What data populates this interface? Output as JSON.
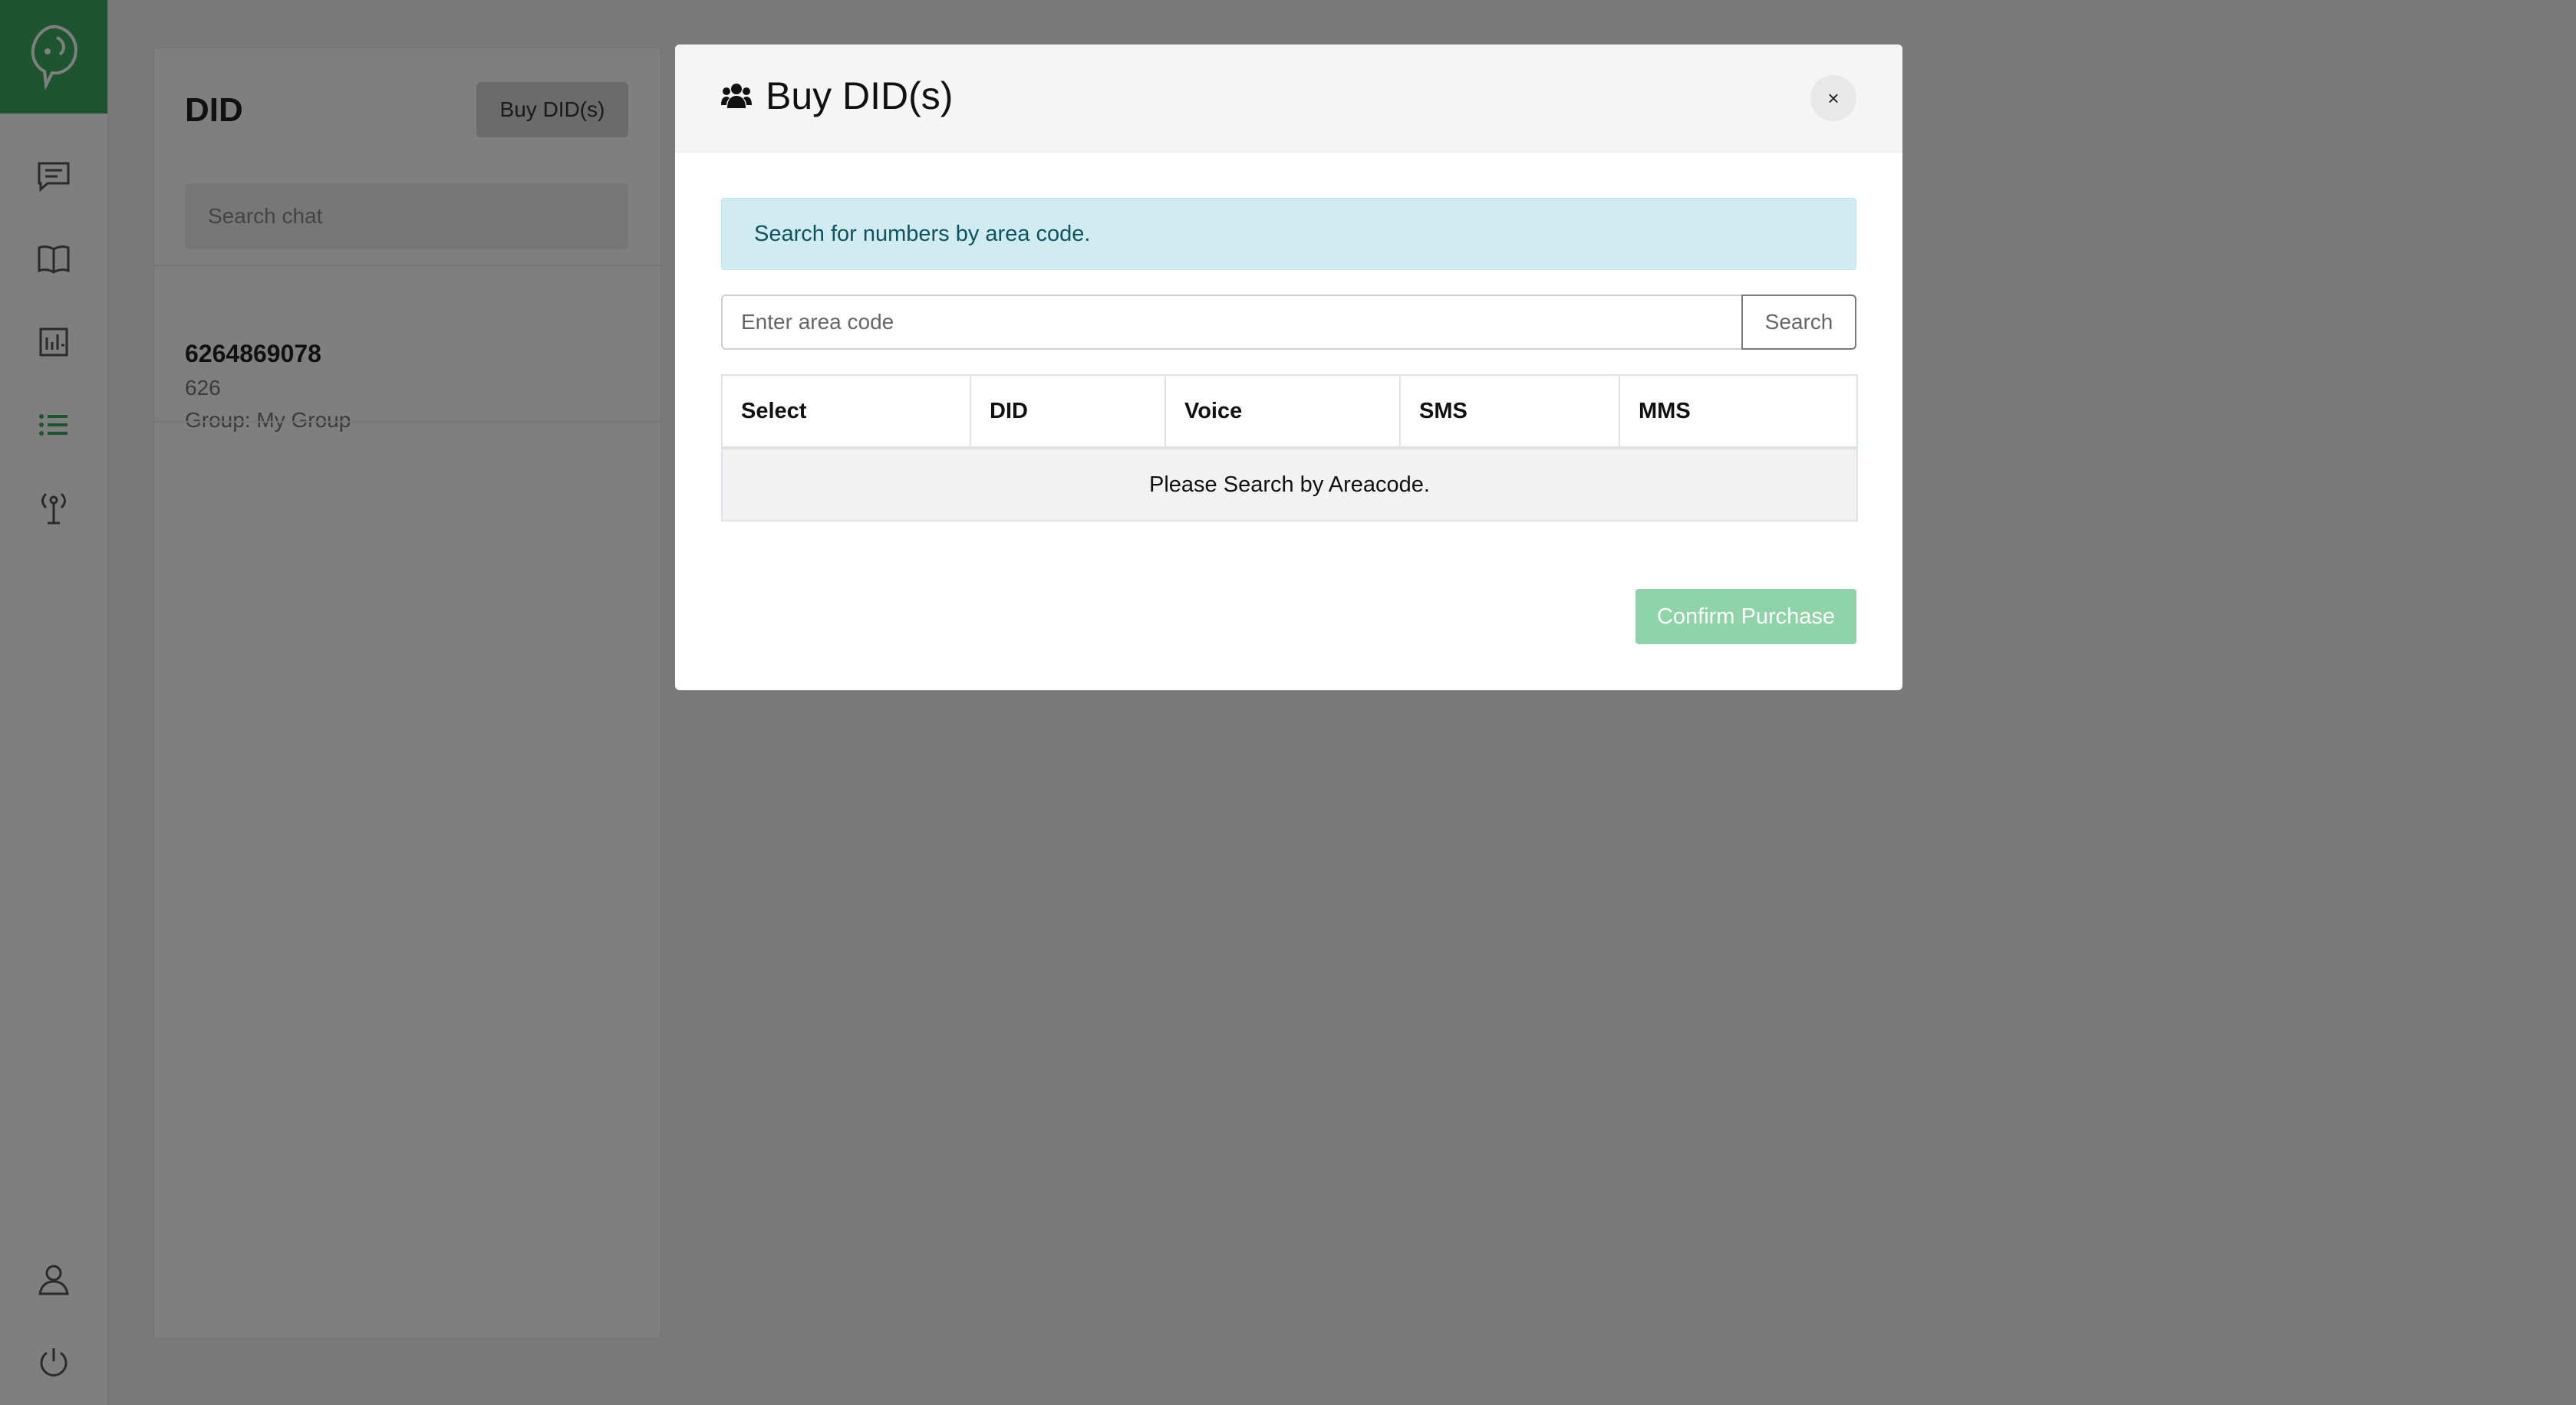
{
  "sidebar": {
    "logo_icon": "chat-leaf-logo",
    "items": [
      {
        "icon": "message-icon"
      },
      {
        "icon": "book-icon"
      },
      {
        "icon": "chart-icon"
      },
      {
        "icon": "list-icon",
        "active": true
      },
      {
        "icon": "antenna-icon"
      }
    ],
    "bottom_items": [
      {
        "icon": "user-icon"
      },
      {
        "icon": "power-icon"
      }
    ]
  },
  "panel": {
    "title": "DID",
    "buy_button": "Buy DID(s)",
    "search_placeholder": "Search chat",
    "contacts": [
      {
        "number": "6264869078",
        "area": "626",
        "group": "Group: My Group"
      }
    ]
  },
  "modal": {
    "title": "Buy DID(s)",
    "title_icon": "users-icon",
    "close_label": "×",
    "alert": "Search for numbers by area code.",
    "input_placeholder": "Enter area code",
    "input_value": "",
    "search_button": "Search",
    "table": {
      "headers": [
        "Select",
        "DID",
        "Voice",
        "SMS",
        "MMS"
      ],
      "empty_message": "Please Search by Areacode."
    },
    "confirm_button": "Confirm Purchase"
  },
  "colors": {
    "brand": "#3daa63",
    "active_icon": "#3daa63",
    "alert_bg": "#d1ecf1",
    "alert_text": "#0c5460",
    "confirm_disabled": "#8fd3a8",
    "overlay": "rgba(0,0,0,0.5)"
  }
}
